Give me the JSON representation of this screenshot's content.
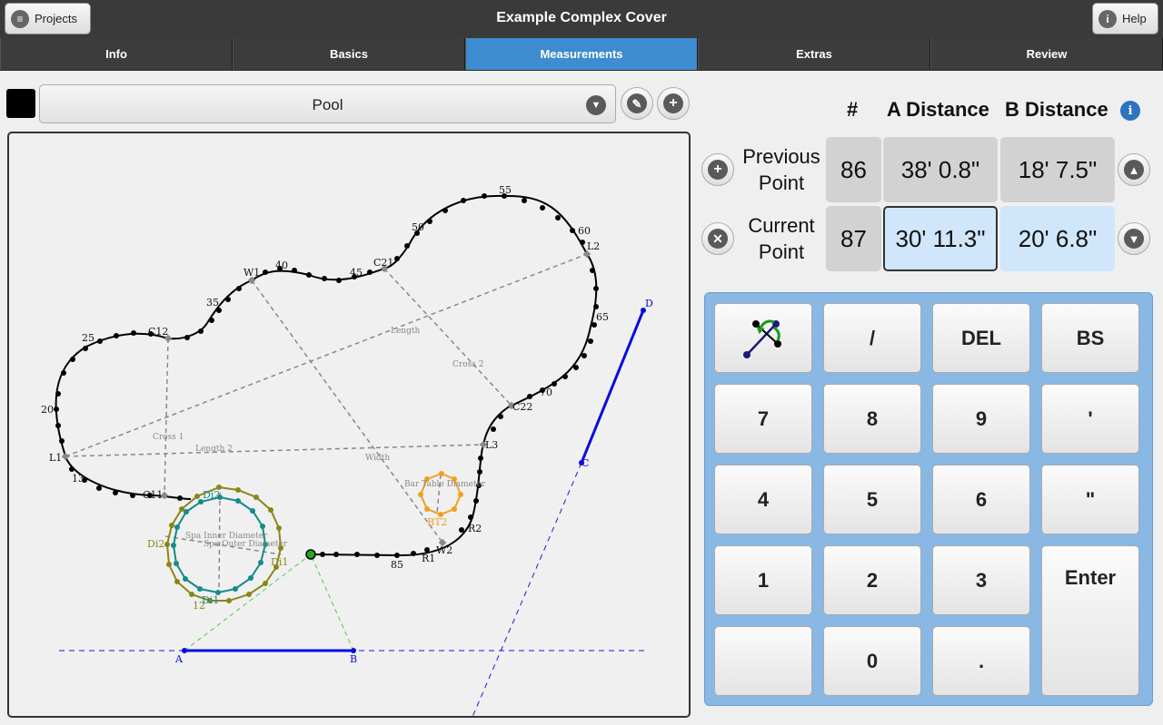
{
  "header": {
    "title": "Example Complex Cover",
    "projects_label": "Projects",
    "help_label": "Help"
  },
  "tabs": [
    {
      "label": "Info"
    },
    {
      "label": "Basics"
    },
    {
      "label": "Measurements",
      "active": true
    },
    {
      "label": "Extras"
    },
    {
      "label": "Review"
    }
  ],
  "feature": {
    "color": "#000000",
    "selected": "Pool"
  },
  "table": {
    "col_num": "#",
    "col_a": "A Distance",
    "col_b": "B Distance",
    "previous": {
      "label_line1": "Previous",
      "label_line2": "Point",
      "num": "86",
      "a": "38' 0.8\"",
      "b": "18' 7.5\""
    },
    "current": {
      "label_line1": "Current",
      "label_line2": "Point",
      "num": "87",
      "a": "30' 11.3\"",
      "b": "20' 6.8\""
    }
  },
  "keypad": {
    "keys": [
      "/",
      "DEL",
      "BS",
      "7",
      "8",
      "9",
      "'",
      "4",
      "5",
      "6",
      "\"",
      "1",
      "2",
      "3",
      "Enter",
      "0",
      "."
    ]
  },
  "drawing": {
    "labels": {
      "pts": [
        "55",
        "60",
        "50",
        "C21",
        "45",
        "40",
        "W1",
        "35",
        "C12",
        "25",
        "20",
        "L1",
        "13",
        "C11",
        "L2",
        "65",
        "70",
        "C22",
        "L3",
        "Bar Table Diameter",
        "BT2",
        "R2",
        "W2",
        "R1",
        "85",
        "A",
        "B",
        "C",
        "D",
        "Length",
        "Cross 2",
        "Cross 1",
        "Length 2",
        "Width",
        "Di2",
        "Spa Inner Diameter",
        "Spa Outer Diameter",
        "Di1",
        "Di1",
        "12",
        "Di2"
      ]
    }
  }
}
